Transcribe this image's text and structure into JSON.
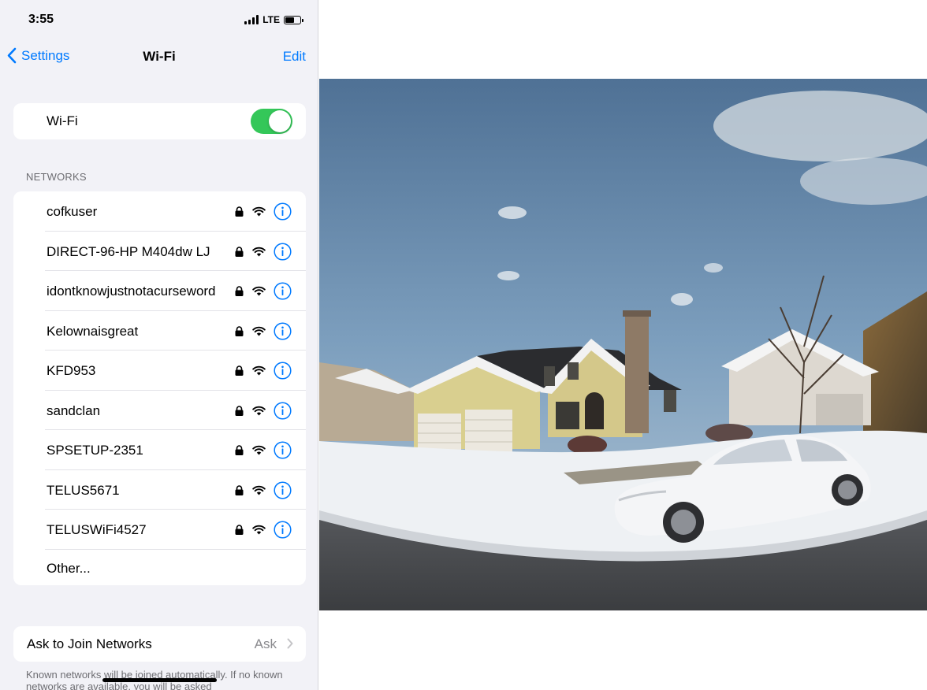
{
  "status_bar": {
    "time": "3:55",
    "network": "LTE",
    "battery_level": 0.6
  },
  "nav": {
    "back_label": "Settings",
    "title": "Wi-Fi",
    "edit_label": "Edit"
  },
  "wifi": {
    "label": "Wi-Fi",
    "enabled": true,
    "toggle_color": "#34c759"
  },
  "networks": {
    "header": "NETWORKS",
    "items": [
      {
        "name": "cofkuser",
        "secured": true
      },
      {
        "name": "DIRECT-96-HP M404dw LJ",
        "secured": true
      },
      {
        "name": "idontknowjustnotacurseword",
        "secured": true
      },
      {
        "name": "Kelownaisgreat",
        "secured": true
      },
      {
        "name": "KFD953",
        "secured": true
      },
      {
        "name": "sandclan",
        "secured": true
      },
      {
        "name": "SPSETUP-2351",
        "secured": true
      },
      {
        "name": "TELUS5671",
        "secured": true
      },
      {
        "name": "TELUSWiFi4527",
        "secured": true
      }
    ],
    "other_label": "Other..."
  },
  "ask_to_join": {
    "label": "Ask to Join Networks",
    "value": "Ask"
  },
  "footer_text": "Known networks will be joined automatically. If no known networks are available, you will be asked",
  "colors": {
    "accent": "#007aff",
    "background": "#f2f2f7"
  },
  "photo": {
    "description_icon": "photo-house-snow"
  }
}
